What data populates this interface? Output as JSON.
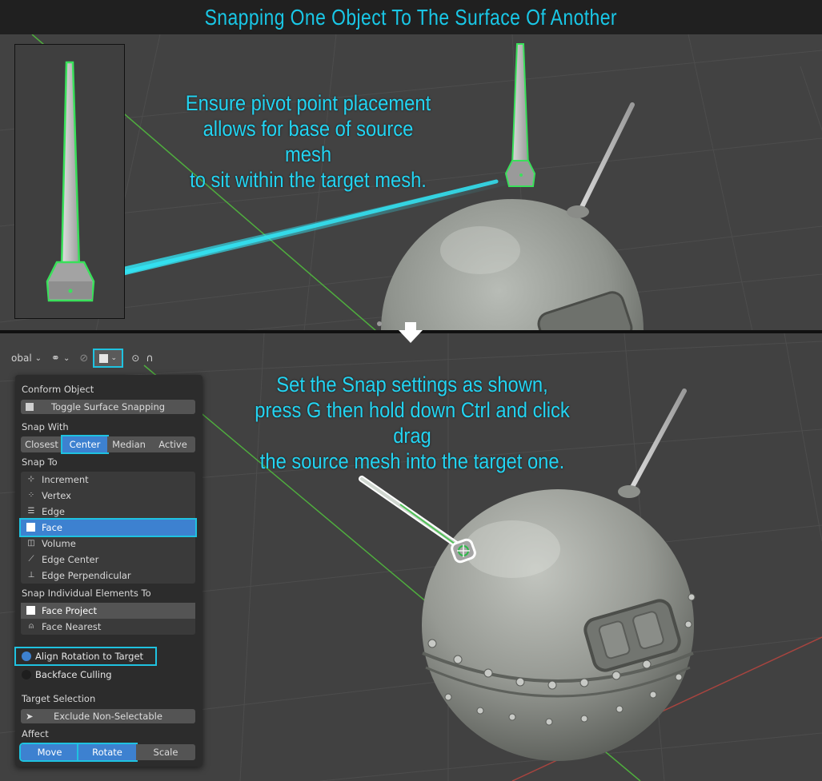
{
  "title": "Snapping One Object To The Surface Of Another",
  "captions": {
    "top": [
      "Ensure pivot point placement",
      "allows for base of source mesh",
      "to sit within the target mesh."
    ],
    "bottom": [
      "Set the Snap settings as shown,",
      "press G then hold down Ctrl and click drag",
      "the source mesh into the target one."
    ]
  },
  "header": {
    "orientation_label": "obal",
    "icons": [
      "pivot-icon",
      "snap-toggle-icon",
      "proportional-icon",
      "falloff-icon"
    ]
  },
  "panel": {
    "conform_object_label": "Conform Object",
    "toggle_surface_snapping": "Toggle Surface Snapping",
    "snap_with_label": "Snap With",
    "snap_with_options": [
      "Closest",
      "Center",
      "Median",
      "Active"
    ],
    "snap_with_selected": "Center",
    "snap_to_label": "Snap To",
    "snap_to_items": [
      "Increment",
      "Vertex",
      "Edge",
      "Face",
      "Volume",
      "Edge Center",
      "Edge Perpendicular"
    ],
    "snap_to_selected": "Face",
    "snap_individual_label": "Snap Individual Elements To",
    "snap_individual_items": [
      "Face Project",
      "Face Nearest"
    ],
    "snap_individual_selected": "Face Project",
    "align_rotation": "Align Rotation to Target",
    "backface_culling": "Backface Culling",
    "target_selection_label": "Target Selection",
    "exclude_non_selectable": "Exclude Non-Selectable",
    "affect_label": "Affect",
    "affect_options": [
      "Move",
      "Rotate",
      "Scale"
    ],
    "affect_selected": [
      "Move",
      "Rotate"
    ]
  },
  "colors": {
    "accent": "#1fc2e0",
    "caption": "#23d4f2",
    "selection_blue": "#3d81d0",
    "outline_green": "#39e05a",
    "grid_green": "#4fae3e",
    "grid_red": "#a8443f"
  }
}
